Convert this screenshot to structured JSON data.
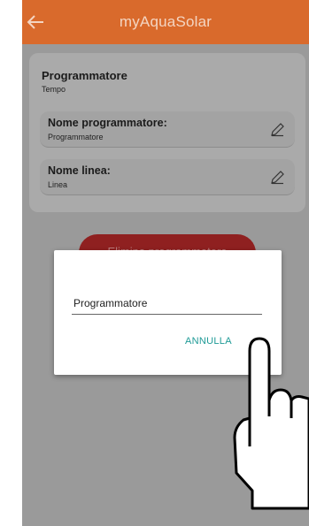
{
  "app": {
    "title": "myAquaSolar"
  },
  "section": {
    "title": "Programmatore",
    "subtitle": "Tempo"
  },
  "fields": [
    {
      "label": "Nome programmatore:",
      "value": "Programmatore"
    },
    {
      "label": "Nome linea:",
      "value": "Linea"
    }
  ],
  "background_button": {
    "label": "Elimina programmatore"
  },
  "dialog": {
    "input_value": "Programmatore",
    "cancel_label": "ANNULLA"
  },
  "icons": {
    "back": "arrow-left-icon",
    "edit": "pencil-icon",
    "pointer": "hand-pointer-icon"
  },
  "colors": {
    "appbar": "#d96a2c",
    "accent": "#1e9a96",
    "danger_button": "#8f2020"
  }
}
